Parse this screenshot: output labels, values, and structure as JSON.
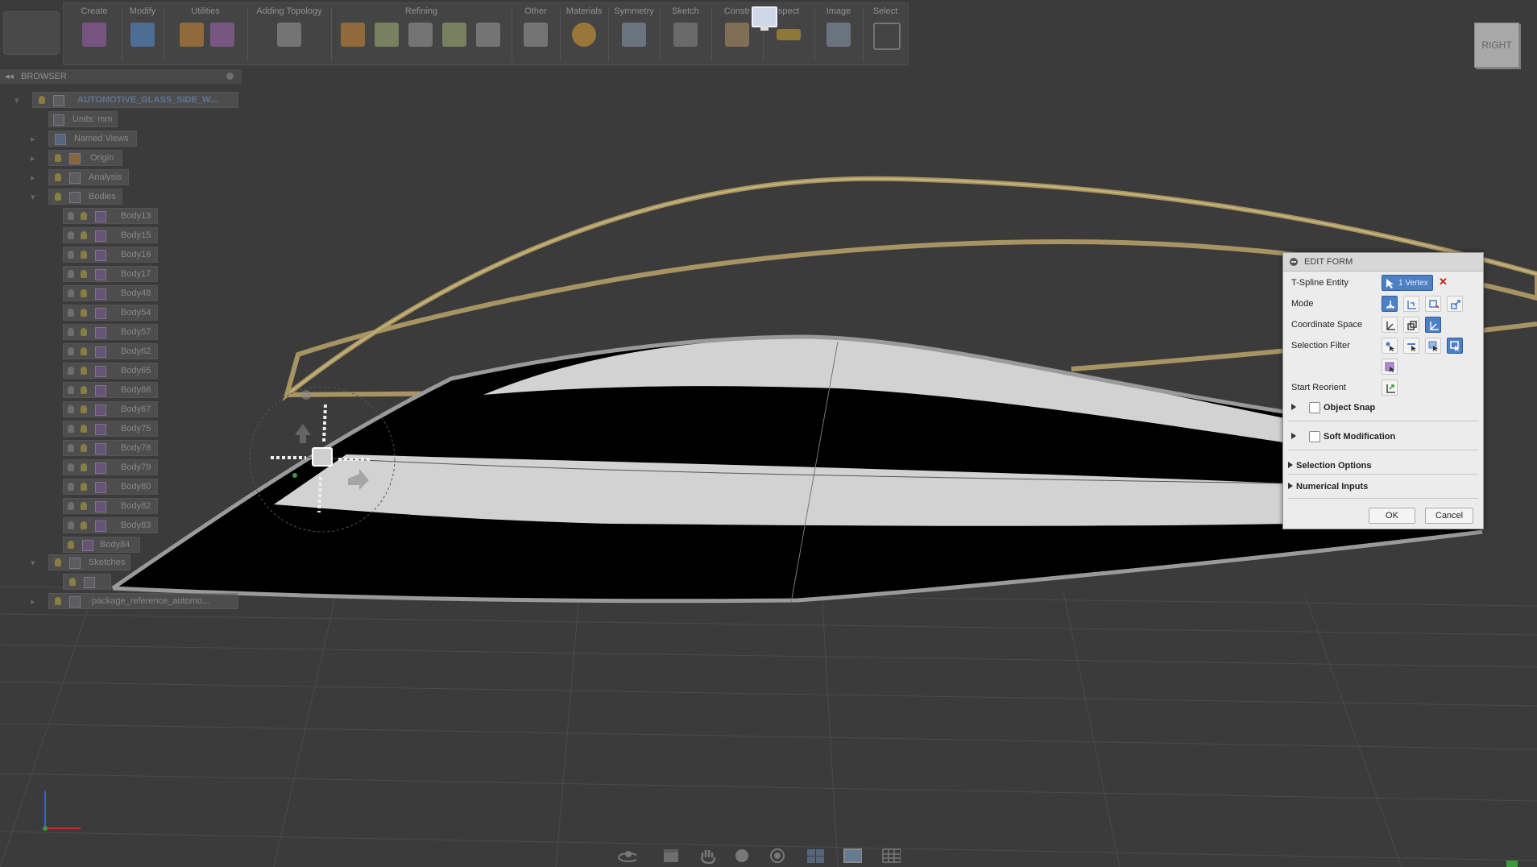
{
  "toolbar": {
    "groups": [
      {
        "label": "Create"
      },
      {
        "label": "Modify"
      },
      {
        "label": "Utilities"
      },
      {
        "label": "Adding Topology"
      },
      {
        "label": "Refining"
      },
      {
        "label": "Other"
      },
      {
        "label": "Materials"
      },
      {
        "label": "Symmetry"
      },
      {
        "label": "Sketch"
      },
      {
        "label": "Constr"
      },
      {
        "label": "spect"
      },
      {
        "label": "Image"
      },
      {
        "label": "Select"
      }
    ]
  },
  "viewcube": {
    "face": "RIGHT"
  },
  "browser": {
    "title": "BROWSER",
    "root": "AUTOMOTIVE_GLASS_SIDE_W...",
    "items": [
      {
        "label": "Units: mm"
      },
      {
        "label": "Named Views"
      },
      {
        "label": "Origin"
      },
      {
        "label": "Analysis"
      },
      {
        "label": "Bodies"
      }
    ],
    "bodies": [
      "Body13",
      "Body15",
      "Body16",
      "Body17",
      "Body48",
      "Body54",
      "Body57",
      "Body62",
      "Body65",
      "Body66",
      "Body67",
      "Body75",
      "Body78",
      "Body79",
      "Body80",
      "Body82",
      "Body83",
      "Body84"
    ],
    "tail": [
      {
        "label": "Sketches"
      },
      {
        "label": ""
      },
      {
        "label": "package_reference_automo..."
      }
    ]
  },
  "dialog": {
    "title": "EDIT FORM",
    "tspline_label": "T-Spline Entity",
    "entity_value": "1 Vertex",
    "mode_label": "Mode",
    "coord_label": "Coordinate Space",
    "filter_label": "Selection Filter",
    "reorient_label": "Start Reorient",
    "object_snap": "Object Snap",
    "soft_mod": "Soft Modification",
    "selection_options": "Selection Options",
    "numerical_inputs": "Numerical Inputs",
    "ok": "OK",
    "cancel": "Cancel"
  },
  "colors": {
    "background": "#3b3b3b",
    "accent": "#4d7fc4",
    "trim_gold": "#b8a56a",
    "glass_light": "#d4d4d4",
    "glass_dark": "#000000"
  }
}
